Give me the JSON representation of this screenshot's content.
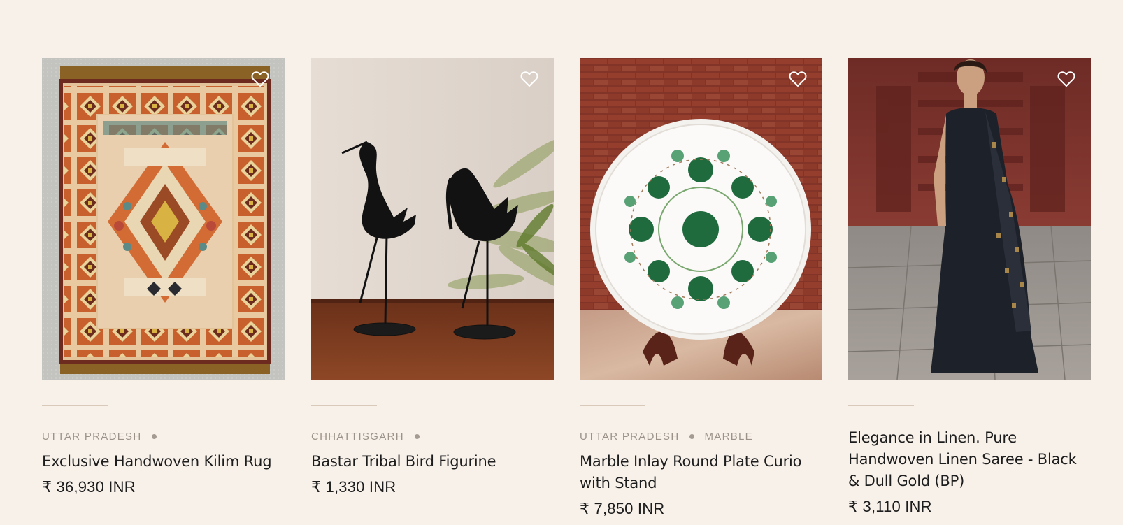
{
  "products": [
    {
      "region": "UTTAR PRADESH",
      "material": "",
      "title": "Exclusive Handwoven Kilim Rug",
      "price": "₹ 36,930 INR"
    },
    {
      "region": "CHHATTISGARH",
      "material": "",
      "title": "Bastar Tribal Bird Figurine",
      "price": "₹ 1,330 INR"
    },
    {
      "region": "UTTAR PRADESH",
      "material": "MARBLE",
      "title": "Marble Inlay Round Plate Curio with Stand",
      "price": "₹ 7,850 INR"
    },
    {
      "region": "",
      "material": "",
      "title": "Elegance in Linen. Pure Handwoven Linen Saree - Black & Dull Gold (BP)",
      "price": "₹ 3,110 INR"
    }
  ],
  "icons": {
    "wishlist": "heart-outline-icon",
    "separator": "dot-icon"
  },
  "colors": {
    "background": "#f8f1ea",
    "meta_text": "#9b9389",
    "title_text": "#1d1d1d",
    "divider": "#d8c9b8"
  }
}
